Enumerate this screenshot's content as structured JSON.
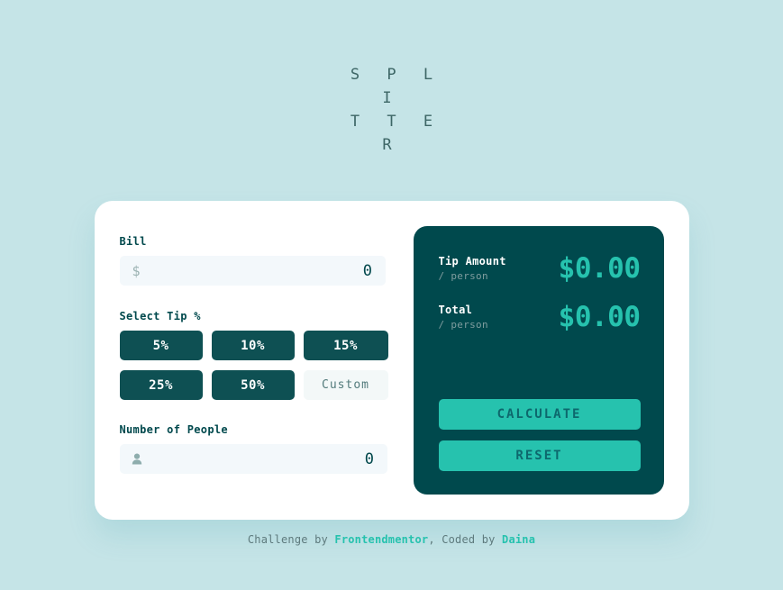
{
  "app": {
    "title_line1": "S P L I",
    "title_line2": "T T E R"
  },
  "colors": {
    "page_background": "#c5e4e7",
    "card_background": "#ffffff",
    "panel_background": "#00494d",
    "accent_strong": "#26c2ae",
    "tip_button": "#0e5053",
    "input_background": "#f3f8fb",
    "text_dark": "#00494d"
  },
  "form": {
    "bill": {
      "label": "Bill",
      "icon": "dollar-icon",
      "icon_glyph": "$",
      "value": "0",
      "placeholder": "0"
    },
    "tip": {
      "label": "Select Tip %",
      "options": [
        {
          "label": "5%",
          "value": 5,
          "selected": false
        },
        {
          "label": "10%",
          "value": 10,
          "selected": false
        },
        {
          "label": "15%",
          "value": 15,
          "selected": false
        },
        {
          "label": "25%",
          "value": 25,
          "selected": false
        },
        {
          "label": "50%",
          "value": 50,
          "selected": false
        }
      ],
      "custom": {
        "label": "Custom",
        "placeholder": "Custom",
        "value": ""
      }
    },
    "people": {
      "label": "Number of People",
      "icon": "person-icon",
      "value": "0",
      "placeholder": "0"
    }
  },
  "results": {
    "rows": [
      {
        "title": "Tip Amount",
        "subtitle": "/ person",
        "value": "$0.00"
      },
      {
        "title": "Total",
        "subtitle": "/ person",
        "value": "$0.00"
      }
    ],
    "calculate_label": "CALCULATE",
    "reset_label": "RESET"
  },
  "footer": {
    "prefix": "Challenge by ",
    "challenge_author": "Frontendmentor",
    "middle": ", Coded by ",
    "coder": "Daina"
  }
}
